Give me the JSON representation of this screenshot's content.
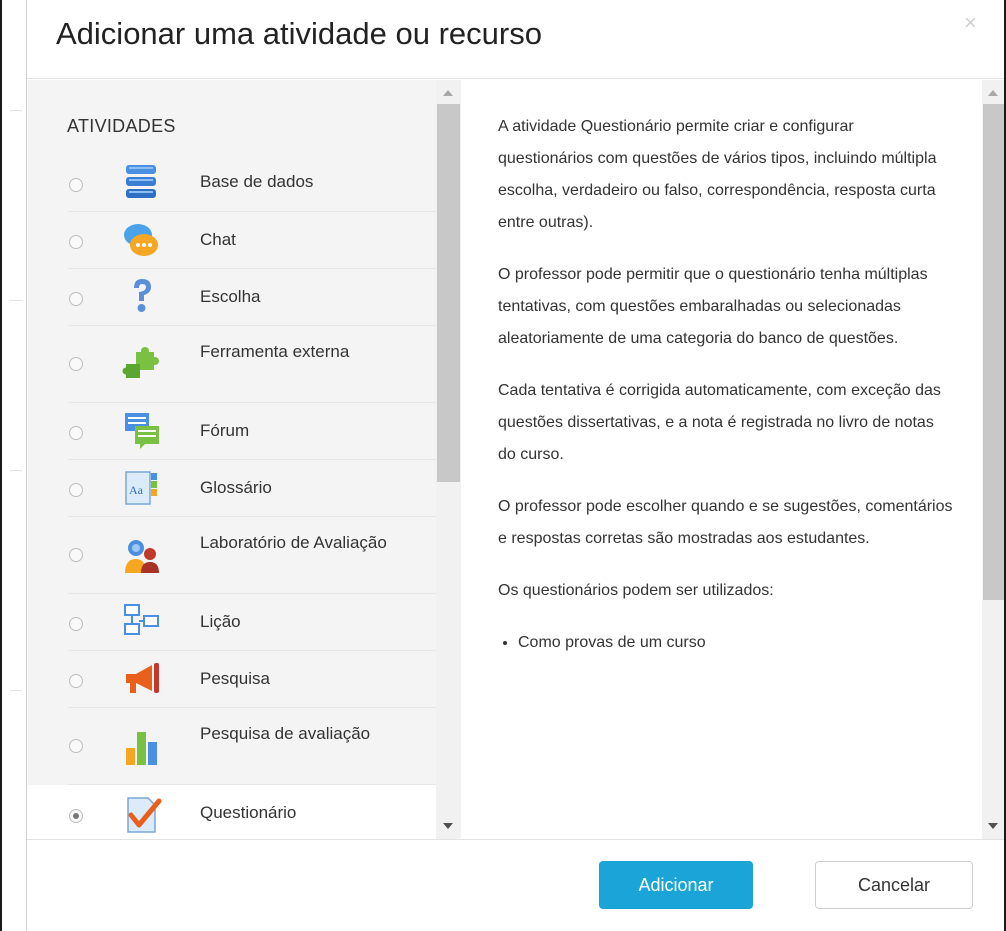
{
  "dialog": {
    "title": "Adicionar uma atividade ou recurso",
    "close_icon": "×"
  },
  "activities": {
    "section_title": "ATIVIDADES",
    "items": [
      {
        "label": "Base de dados",
        "icon": "database-icon",
        "selected": false
      },
      {
        "label": "Chat",
        "icon": "chat-icon",
        "selected": false
      },
      {
        "label": "Escolha",
        "icon": "question-icon",
        "selected": false
      },
      {
        "label": "Ferramenta externa",
        "icon": "puzzle-icon",
        "selected": false
      },
      {
        "label": "Fórum",
        "icon": "forum-icon",
        "selected": false
      },
      {
        "label": "Glossário",
        "icon": "glossary-icon",
        "selected": false
      },
      {
        "label": "Laboratório de Avaliação",
        "icon": "workshop-icon",
        "selected": false
      },
      {
        "label": "Lição",
        "icon": "lesson-icon",
        "selected": false
      },
      {
        "label": "Pesquisa",
        "icon": "megaphone-icon",
        "selected": false
      },
      {
        "label": "Pesquisa de avaliação",
        "icon": "bar-chart-icon",
        "selected": false
      },
      {
        "label": "Questionário",
        "icon": "quiz-icon",
        "selected": true
      }
    ]
  },
  "description": {
    "paragraphs": [
      "A atividade Questionário permite criar e configurar questionários com questões de vários tipos, incluindo múltipla escolha, verdadeiro ou falso, correspondência, resposta curta entre outras).",
      "O professor pode permitir que o questionário tenha múltiplas tentativas, com questões embaralhadas ou selecionadas aleatoriamente de uma categoria do banco de questões.",
      "Cada tentativa é corrigida automaticamente, com exceção das questões dissertativas, e a nota é registrada no livro de notas do curso.",
      "O professor pode escolher quando e se sugestões, comentários e respostas corretas são mostradas aos estudantes.",
      "Os questionários podem ser utilizados:"
    ],
    "bullets": [
      "Como provas de um curso"
    ]
  },
  "footer": {
    "add_label": "Adicionar",
    "cancel_label": "Cancelar"
  },
  "colors": {
    "primary": "#1aa4d8"
  }
}
